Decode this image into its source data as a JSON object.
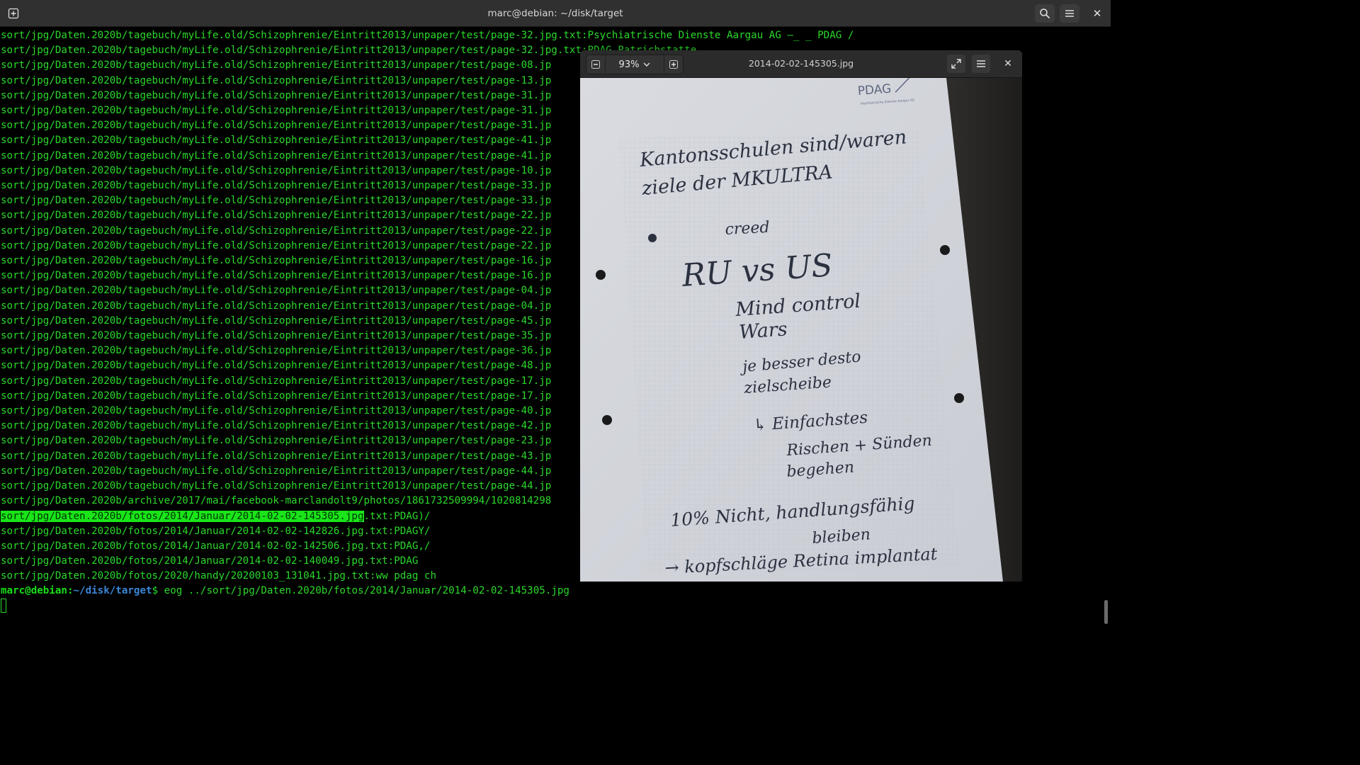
{
  "terminal": {
    "title": "marc@debian: ~/disk/target",
    "lines": [
      "sort/jpg/Daten.2020b/tagebuch/myLife.old/Schizophrenie/Eintritt2013/unpaper/test/page-32.jpg.txt:Psychiatrische Dienste Aargau AG —_ _ PDAG /",
      "sort/jpg/Daten.2020b/tagebuch/myLife.old/Schizophrenie/Eintritt2013/unpaper/test/page-32.jpg.txt:PDAG Patrichstatte",
      "sort/jpg/Daten.2020b/tagebuch/myLife.old/Schizophrenie/Eintritt2013/unpaper/test/page-08.jp",
      "sort/jpg/Daten.2020b/tagebuch/myLife.old/Schizophrenie/Eintritt2013/unpaper/test/page-13.jp",
      "sort/jpg/Daten.2020b/tagebuch/myLife.old/Schizophrenie/Eintritt2013/unpaper/test/page-31.jp",
      "sort/jpg/Daten.2020b/tagebuch/myLife.old/Schizophrenie/Eintritt2013/unpaper/test/page-31.jp",
      "sort/jpg/Daten.2020b/tagebuch/myLife.old/Schizophrenie/Eintritt2013/unpaper/test/page-31.jp",
      "sort/jpg/Daten.2020b/tagebuch/myLife.old/Schizophrenie/Eintritt2013/unpaper/test/page-41.jp",
      "sort/jpg/Daten.2020b/tagebuch/myLife.old/Schizophrenie/Eintritt2013/unpaper/test/page-41.jp",
      "sort/jpg/Daten.2020b/tagebuch/myLife.old/Schizophrenie/Eintritt2013/unpaper/test/page-10.jp",
      "sort/jpg/Daten.2020b/tagebuch/myLife.old/Schizophrenie/Eintritt2013/unpaper/test/page-33.jp",
      "sort/jpg/Daten.2020b/tagebuch/myLife.old/Schizophrenie/Eintritt2013/unpaper/test/page-33.jp",
      "sort/jpg/Daten.2020b/tagebuch/myLife.old/Schizophrenie/Eintritt2013/unpaper/test/page-22.jp",
      "sort/jpg/Daten.2020b/tagebuch/myLife.old/Schizophrenie/Eintritt2013/unpaper/test/page-22.jp",
      "sort/jpg/Daten.2020b/tagebuch/myLife.old/Schizophrenie/Eintritt2013/unpaper/test/page-22.jp",
      "sort/jpg/Daten.2020b/tagebuch/myLife.old/Schizophrenie/Eintritt2013/unpaper/test/page-16.jp",
      "sort/jpg/Daten.2020b/tagebuch/myLife.old/Schizophrenie/Eintritt2013/unpaper/test/page-16.jp",
      "sort/jpg/Daten.2020b/tagebuch/myLife.old/Schizophrenie/Eintritt2013/unpaper/test/page-04.jp",
      "sort/jpg/Daten.2020b/tagebuch/myLife.old/Schizophrenie/Eintritt2013/unpaper/test/page-04.jp",
      "sort/jpg/Daten.2020b/tagebuch/myLife.old/Schizophrenie/Eintritt2013/unpaper/test/page-45.jp",
      "sort/jpg/Daten.2020b/tagebuch/myLife.old/Schizophrenie/Eintritt2013/unpaper/test/page-35.jp",
      "sort/jpg/Daten.2020b/tagebuch/myLife.old/Schizophrenie/Eintritt2013/unpaper/test/page-36.jp",
      "sort/jpg/Daten.2020b/tagebuch/myLife.old/Schizophrenie/Eintritt2013/unpaper/test/page-48.jp",
      "sort/jpg/Daten.2020b/tagebuch/myLife.old/Schizophrenie/Eintritt2013/unpaper/test/page-17.jp",
      "sort/jpg/Daten.2020b/tagebuch/myLife.old/Schizophrenie/Eintritt2013/unpaper/test/page-17.jp",
      "sort/jpg/Daten.2020b/tagebuch/myLife.old/Schizophrenie/Eintritt2013/unpaper/test/page-40.jp",
      "sort/jpg/Daten.2020b/tagebuch/myLife.old/Schizophrenie/Eintritt2013/unpaper/test/page-42.jp",
      "sort/jpg/Daten.2020b/tagebuch/myLife.old/Schizophrenie/Eintritt2013/unpaper/test/page-23.jp",
      "sort/jpg/Daten.2020b/tagebuch/myLife.old/Schizophrenie/Eintritt2013/unpaper/test/page-43.jp",
      "sort/jpg/Daten.2020b/tagebuch/myLife.old/Schizophrenie/Eintritt2013/unpaper/test/page-44.jp",
      "sort/jpg/Daten.2020b/tagebuch/myLife.old/Schizophrenie/Eintritt2013/unpaper/test/page-44.jp",
      "sort/jpg/Daten.2020b/archive/2017/mai/facebook-marclandolt9/photos/1861732509994/1020814298"
    ],
    "highlight_line": {
      "match": "sort/jpg/Daten.2020b/fotos/2014/Januar/2014-02-02-145305.jpg",
      "rest": ".txt:PDAG)/"
    },
    "lines_after": [
      "sort/jpg/Daten.2020b/fotos/2014/Januar/2014-02-02-142826.jpg.txt:PDAGY/",
      "sort/jpg/Daten.2020b/fotos/2014/Januar/2014-02-02-142506.jpg.txt:PDAG,/",
      "sort/jpg/Daten.2020b/fotos/2014/Januar/2014-02-02-140049.jpg.txt:PDAG",
      "sort/jpg/Daten.2020b/fotos/2020/handy/20200103_131041.jpg.txt:ww pdag ch"
    ],
    "prompt": {
      "user": "marc@debian",
      "sep": ":",
      "path": "~/disk/target",
      "dollar": "$ ",
      "command": "eog ../sort/jpg/Daten.2020b/fotos/2014/Januar/2014-02-02-145305.jpg"
    }
  },
  "viewer": {
    "title": "2014-02-02-145305.jpg",
    "zoom": "93%",
    "icons": {
      "zoom_out": "minus-icon",
      "zoom_in": "plus-icon",
      "fullscreen": "fullscreen-icon",
      "menu": "hamburger-menu-icon",
      "close": "close-icon"
    },
    "photo": {
      "logo": "PDAG",
      "logo_sub": "Psychiatrische Dienste Aargau AG",
      "handwriting": [
        "Kantonsschulen sind/waren",
        "ziele der MKULTRA",
        "creed",
        "RU vs US",
        "Mind control",
        "Wars",
        "je besser desto",
        "zielscheibe",
        "↳ Einfachstes",
        "Rischen + Sünden",
        "begehen",
        "10% Nicht, handlungsfähig",
        "bleiben",
        "→ kopfschläge Retina implantat"
      ]
    }
  },
  "colors": {
    "terminal_text": "#2bd92b",
    "highlight_bg": "#19e519",
    "prompt_path": "#3a86d6",
    "header_bg": "#303030"
  }
}
